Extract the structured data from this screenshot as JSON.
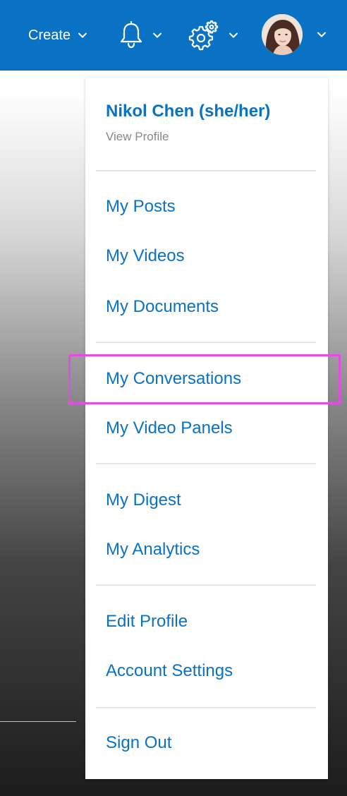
{
  "topbar": {
    "create_label": "Create",
    "background_color": "#0a72c4",
    "icons": [
      "chevron-down-icon",
      "bell-icon",
      "gear-icon",
      "avatar"
    ]
  },
  "profile": {
    "name": "Nikol Chen (she/her)",
    "view_profile": "View Profile"
  },
  "menu": {
    "groups": [
      [
        "My Posts",
        "My Videos",
        "My Documents"
      ],
      [
        "My Conversations",
        "My Video Panels"
      ],
      [
        "My Digest",
        "My Analytics"
      ],
      [
        "Edit Profile",
        "Account Settings"
      ],
      [
        "Sign Out"
      ]
    ],
    "highlighted": "My Conversations",
    "link_color": "#0a72c4",
    "highlight_color": "#e64be6"
  }
}
